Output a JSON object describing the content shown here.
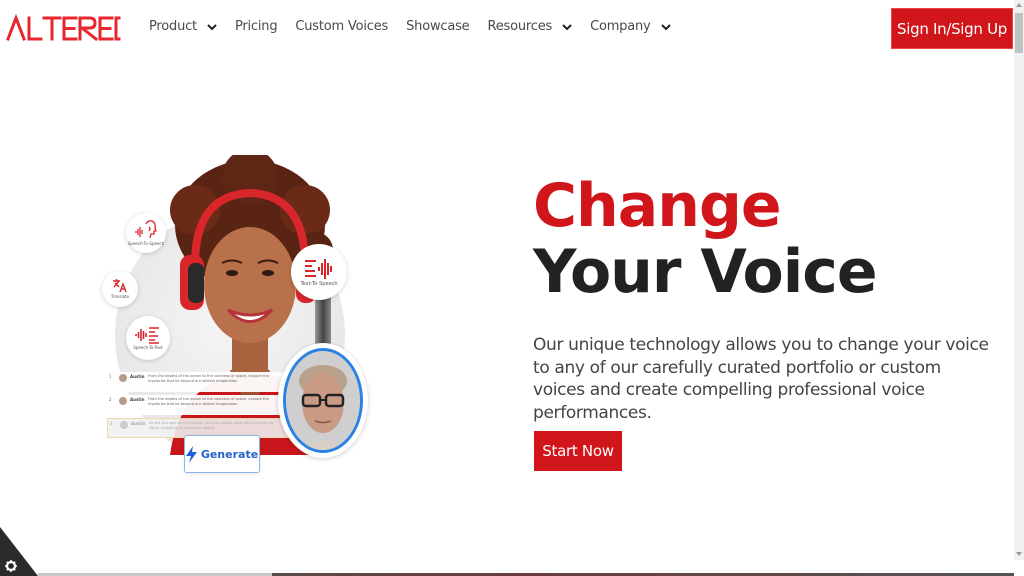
{
  "header": {
    "logo_text": "ALTERED",
    "nav": [
      {
        "label": "Product",
        "has_dropdown": true
      },
      {
        "label": "Pricing",
        "has_dropdown": false
      },
      {
        "label": "Custom Voices",
        "has_dropdown": false
      },
      {
        "label": "Showcase",
        "has_dropdown": false
      },
      {
        "label": "Resources",
        "has_dropdown": true
      },
      {
        "label": "Company",
        "has_dropdown": true
      }
    ],
    "signin_label": "Sign In/Sign Up"
  },
  "hero": {
    "title_line1": "Change",
    "title_line2": "Your Voice",
    "description": "Our unique technology allows you to change your voice to any of our carefully curated portfolio or custom voices and create compelling professional voice performances.",
    "cta_label": "Start Now"
  },
  "illustration": {
    "features": [
      {
        "label": "Speech-To-Speech",
        "icon": "speech-to-speech-icon"
      },
      {
        "label": "Translate",
        "icon": "translate-icon"
      },
      {
        "label": "Speech-To-Text",
        "icon": "speech-to-text-icon"
      },
      {
        "label": "Text-To-Speech",
        "icon": "text-to-speech-icon"
      }
    ],
    "script_rows": [
      {
        "num": "1",
        "speaker": "Austin",
        "role": "",
        "text": "From the depths of the ocean to the vastness of space, explore the mysteries that lie beyond our wildest imagination"
      },
      {
        "num": "2",
        "speaker": "Austin",
        "role": "Neutral",
        "text": "From the depths of the ocean to the vastness of space, explore the mysteries that lie beyond our wildest imagination"
      },
      {
        "num": "3",
        "speaker": "Austin",
        "role": "Tired",
        "text": "As the sun sets on the horizon, the city comes alive with shimmering lights, revealing its nocturnal beauty"
      }
    ],
    "generate_label": "Generate"
  },
  "colors": {
    "brand_red": "#d0161b",
    "heading_dark": "#222222",
    "generate_blue": "#2662c9",
    "avatar_ring": "#2a82e4"
  }
}
